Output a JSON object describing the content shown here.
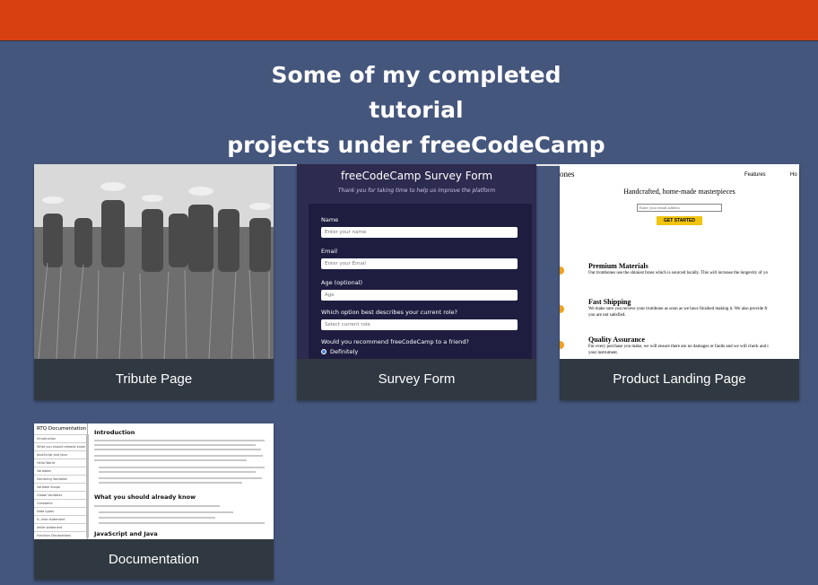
{
  "heading": {
    "line1": "Some of my completed tutorial",
    "line2": "projects under freeCodeCamp"
  },
  "projects": [
    {
      "title": "Tribute Page"
    },
    {
      "title": "Survey Form"
    },
    {
      "title": "Product Landing Page"
    },
    {
      "title": "Documentation"
    }
  ],
  "survey_preview": {
    "title": "freeCodeCamp Survey Form",
    "subtitle": "Thank you for taking time to help us improve the platform",
    "fields": [
      {
        "label": "Name",
        "placeholder": "Enter your name"
      },
      {
        "label": "Email",
        "placeholder": "Enter your Email"
      },
      {
        "label": "Age (optional)",
        "placeholder": "Age"
      },
      {
        "label": "Which option best describes your current role?",
        "placeholder": "Select current role"
      }
    ],
    "question": "Would you recommend freeCodeCamp to a friend?",
    "option": "Definitely"
  },
  "product_preview": {
    "brand": "ones",
    "nav": [
      "Features",
      "Ho"
    ],
    "headline": "Handcrafted, home-made masterpieces",
    "email_placeholder": "Enter your email address",
    "cta": "GET STARTED",
    "features": [
      {
        "title": "Premium Materials",
        "text": "Our trombones use the shiniest brass which is sourced locally. This will increase the longevity of yo"
      },
      {
        "title": "Fast Shipping",
        "text": "We make sure you recieve your trombone as soon as we have finished making it. We also provide fr",
        "text2": "you are not satisfied."
      },
      {
        "title": "Quality Assurance",
        "text": "For every purchase you make, we will ensure there are no damages or faults and we will check and t",
        "text2": "your instrument."
      }
    ]
  },
  "docs_preview": {
    "nav_title": "RTQ Documentation",
    "nav_items": [
      "Introduction",
      "What you should already know",
      "JavaScript and Java",
      "Hello World",
      "Variables",
      "Declaring Variables",
      "Variable Scope",
      "Global Variables",
      "Constants",
      "Data types",
      "if...else statement",
      "while statement",
      "Function Declarations"
    ],
    "h1": "Introduction",
    "h2": "What you should already know",
    "h3": "JavaScript and Java"
  },
  "colors": {
    "background": "#45567d",
    "topbar": "#d84012",
    "card": "#303841"
  }
}
